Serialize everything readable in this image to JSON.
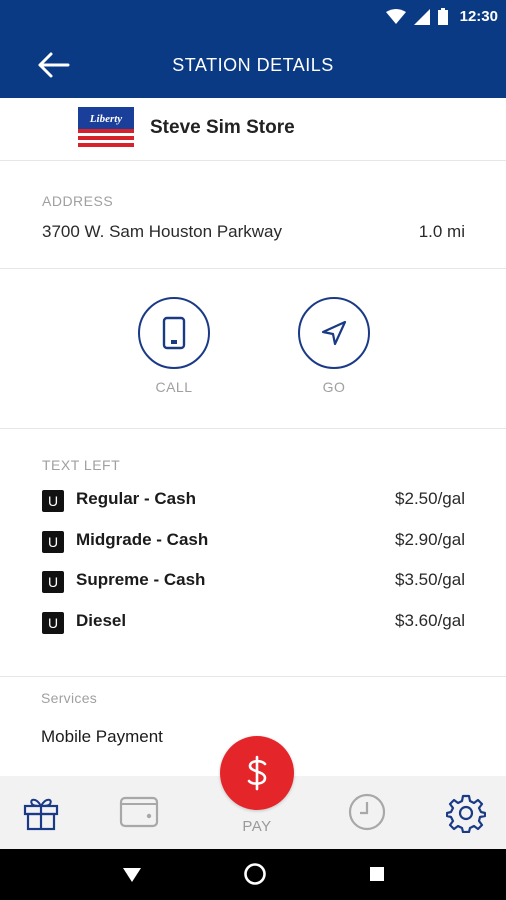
{
  "status_bar": {
    "time": "12:30"
  },
  "app_bar": {
    "title": "STATION DETAILS"
  },
  "station": {
    "name": "Steve Sim Store",
    "brand_logo_text": "Liberty"
  },
  "address": {
    "label": "ADDRESS",
    "line": "3700 W. Sam Houston Parkway",
    "distance": "1.0 mi"
  },
  "actions": [
    {
      "label": "CALL",
      "icon": "phone-icon"
    },
    {
      "label": "GO",
      "icon": "navigation-arrow-icon"
    }
  ],
  "prices": {
    "label": "TEXT LEFT",
    "items": [
      {
        "badge": "U",
        "name": "Regular - Cash",
        "price": "$2.50/gal"
      },
      {
        "badge": "U",
        "name": "Midgrade - Cash",
        "price": "$2.90/gal"
      },
      {
        "badge": "U",
        "name": "Supreme - Cash",
        "price": "$3.50/gal"
      },
      {
        "badge": "U",
        "name": "Diesel",
        "price": "$3.60/gal"
      }
    ]
  },
  "services": {
    "label": "Services",
    "items": [
      "Mobile Payment"
    ]
  },
  "bottom_nav": {
    "pay_label": "PAY",
    "items": [
      "gift-icon",
      "wallet-icon",
      "dollar-icon",
      "history-clock-icon",
      "settings-gear-icon"
    ]
  },
  "colors": {
    "primary": "#0b3a84",
    "accent_red": "#e4262b",
    "nav_bg": "#f2f2f2"
  }
}
